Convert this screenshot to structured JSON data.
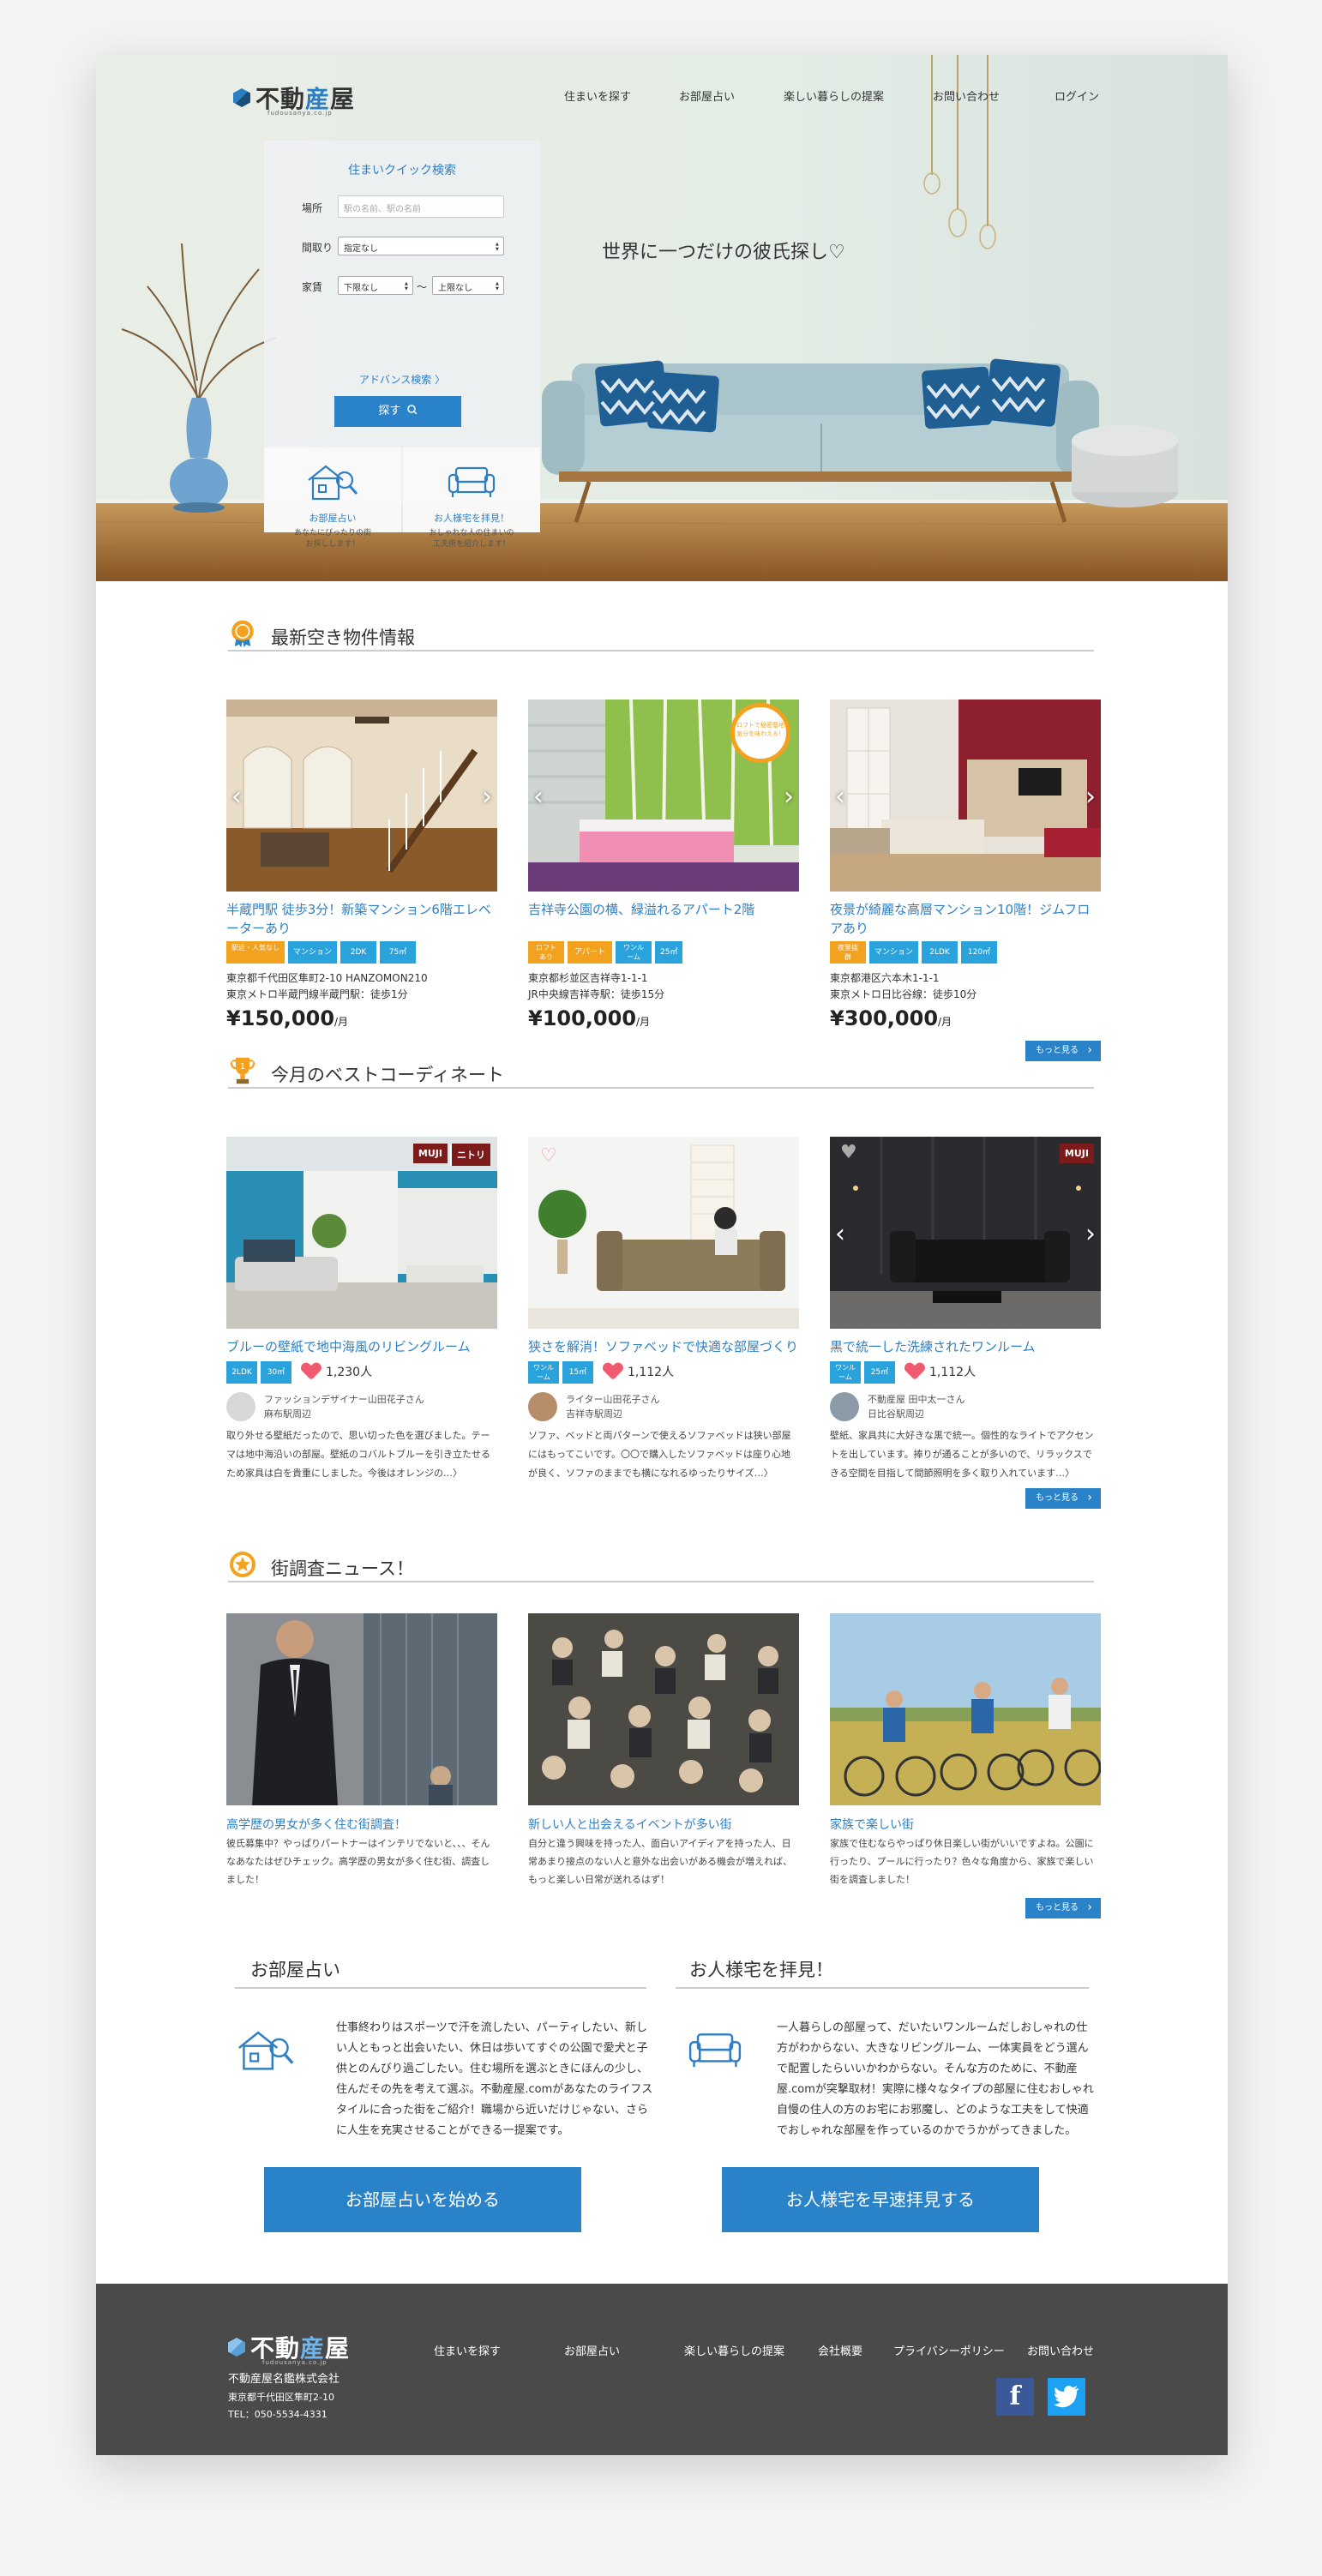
{
  "brand": {
    "name_part1": "不動",
    "name_part2": "産",
    "name_part3": "屋",
    "sub": "fudousanya.co.jp"
  },
  "nav": [
    "住まいを探す",
    "お部屋占い",
    "楽しい暮らしの提案",
    "お問い合わせ",
    "ログイン"
  ],
  "search": {
    "title": "住まいクイック検索",
    "location_label": "場所",
    "location_placeholder": "駅の名前、駅の名前",
    "layout_label": "間取り",
    "layout_value": "指定なし",
    "rent_label": "家賃",
    "rent_min": "下限なし",
    "rent_sep": "〜",
    "rent_max": "上限なし",
    "advanced": "アドバンス検索 〉",
    "button": "探す"
  },
  "promo_cards": [
    {
      "title": "お部屋占い",
      "text1": "あなたにぴったりの街",
      "text2": "お探しします！"
    },
    {
      "title": "お人様宅を拝見！",
      "text1": "おしゃれな人の住まいの",
      "text2": "工夫術を紹介します！"
    }
  ],
  "hero_title": "世界に一つだけの彼氏探し♡",
  "sections": {
    "new": "最新空き物件情報",
    "best": "今月のベストコーディネート",
    "news": "街調査ニュース！"
  },
  "more_label": "もっと見る",
  "properties": [
    {
      "title": "半蔵門駅 徒歩3分！新築マンション6階エレベーターあり",
      "tags": [
        [
          "o",
          "駅近・人気なし"
        ],
        [
          "b",
          "マンション"
        ],
        [
          "b",
          "2DK"
        ],
        [
          "b",
          "75㎡"
        ]
      ],
      "addr1": "東京都千代田区隼町2-10 HANZOMON210",
      "addr2": "東京メトロ半蔵門線半蔵門駅：徒歩1分",
      "price": "¥150,000",
      "unit": "/月"
    },
    {
      "title": "吉祥寺公園の横、緑溢れるアパート2階",
      "tags": [
        [
          "o",
          "ロフトあり"
        ],
        [
          "o",
          "アパート"
        ],
        [
          "b",
          "ワンルーム"
        ],
        [
          "b",
          "25㎡"
        ]
      ],
      "addr1": "東京都杉並区吉祥寺1-1-1",
      "addr2": "JR中央線吉祥寺駅：徒歩15分",
      "price": "¥100,000",
      "unit": "/月",
      "ribbon": "ロフトで秘密基地気分を味わえる！"
    },
    {
      "title": "夜景が綺麗な高層マンション10階！ジムフロアあり",
      "tags": [
        [
          "o",
          "夜景抜群"
        ],
        [
          "b",
          "マンション"
        ],
        [
          "b",
          "2LDK"
        ],
        [
          "b",
          "120㎡"
        ]
      ],
      "addr1": "東京都港区六本木1-1-1",
      "addr2": "東京メトロ日比谷線：徒歩10分",
      "price": "¥300,000",
      "unit": "/月"
    }
  ],
  "coordinates": [
    {
      "title": "ブルーの壁紙で地中海風のリビングルーム",
      "tags": [
        "2LDK",
        "30㎡"
      ],
      "likes": "1,230人",
      "author1": "ファッションデザイナー山田花子さん",
      "author2": "麻布駅周辺",
      "desc": "取り外せる壁紙だったので、思い切った色を選びました。テーマは地中海沿いの部屋。壁紙のコバルトブルーを引き立たせるため家具は白を貴重にしました。今後はオレンジの…〉",
      "brand1": "MUJI",
      "brand2": "ニトリ"
    },
    {
      "title": "狭さを解消！ソファベッドで快適な部屋づくり",
      "tags": [
        "ワンルーム",
        "15㎡"
      ],
      "likes": "1,112人",
      "author1": "ライター山田花子さん",
      "author2": "吉祥寺駅周辺",
      "desc": "ソファ、ベッドと両パターンで使えるソファベッドは狭い部屋にはもってこいです。〇〇で購入したソファベッドは座り心地が良く、ソファのままでも横になれるゆったりサイズ…〉"
    },
    {
      "title": "黒で統一した洗練されたワンルーム",
      "tags": [
        "ワンルーム",
        "25㎡"
      ],
      "likes": "1,112人",
      "author1": "不動産屋 田中太一さん",
      "author2": "日比谷駅周辺",
      "desc": "壁紙、家具共に大好きな黒で統一。個性的なライトでアクセントを出しています。捧りが通ることが多いので、リラックスできる空間を目指して間節照明を多く取り入れています…〉",
      "brand1": "MUJI"
    }
  ],
  "news": [
    {
      "title": "高学歴の男女が多く住む街調査！",
      "desc": "彼氏募集中？やっぱりパートナーはインテリでないと、、、そんなあなたはぜひチェック。高学歴の男女が多く住む街、調査しました！"
    },
    {
      "title": "新しい人と出会えるイベントが多い街",
      "desc": "自分と違う興味を持った人、面白いアイディアを持った人、日常あまり接点のない人と意外な出会いがある機会が増えれば、もっと楽しい日常が送れるはず！"
    },
    {
      "title": "家族で楽しい街",
      "desc": "家族で住むならやっぱり休日楽しい街がいいですよね。公園に行ったり、プールに行ったり？色々な角度から、家族で楽しい街を調査しました！"
    }
  ],
  "bottom": {
    "left_head": "お部屋占い",
    "left_text": "仕事終わりはスポーツで汗を流したい、パーティしたい、新しい人ともっと出会いたい、休日は歩いてすぐの公園で愛犬と子供とのんびり過ごしたい。住む場所を選ぶときにほんの少し、住んだその先を考えて選ぶ。不動産屋.comがあなたのライフスタイルに合った街をご紹介！職場から近いだけじゃない、さらに人生を充実させることができる一提案です。",
    "left_cta": "お部屋占いを始める",
    "right_head": "お人様宅を拝見！",
    "right_text": "一人暮らしの部屋って、だいたいワンルームだしおしゃれの仕方がわからない、大きなリビングルーム、一体実員をどう選んで配置したらいいかわからない。そんな方のために、不動産屋.comが突撃取材！実際に様々なタイプの部屋に住むおしゃれ自慢の住人の方のお宅にお邪魔し、どのような工夫をして快適でおしゃれな部屋を作っているのかでうかがってきました。",
    "right_cta": "お人様宅を早速拝見する"
  },
  "footer": {
    "company": "不動産屋名鑑株式会社",
    "address": "東京都千代田区隼町2-10",
    "tel": "TEL：050-5534-4331",
    "links": [
      "住まいを探す",
      "お部屋占い",
      "楽しい暮らしの提案",
      "会社概要",
      "プライバシーポリシー",
      "お問い合わせ"
    ],
    "facebook": "f",
    "twitter_icon": "twitter-bird"
  },
  "colors": {
    "accent": "#2a82c9",
    "link": "#2f7fc4",
    "orange": "#f3a21f",
    "tagblue": "#2aa3dc",
    "footer": "#4a4a4a",
    "heart": "#ef5a6f"
  }
}
